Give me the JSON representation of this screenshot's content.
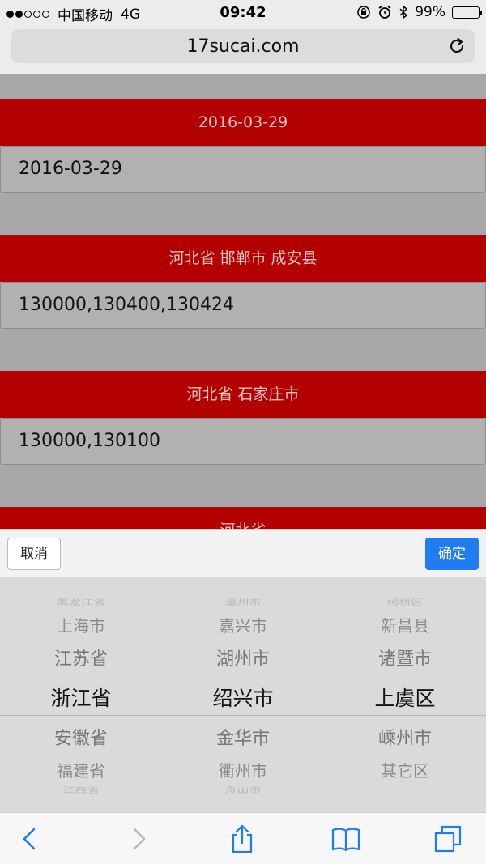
{
  "status": {
    "carrier": "中国移动",
    "network": "4G",
    "time": "09:42",
    "battery": "99%",
    "battery_level": 0.99
  },
  "browser": {
    "url": "17sucai.com"
  },
  "blocks": [
    {
      "title": "2016-03-29",
      "value": "2016-03-29"
    },
    {
      "title": "河北省 邯郸市 成安县",
      "value": "130000,130400,130424"
    },
    {
      "title": "河北省 石家庄市",
      "value": "130000,130100"
    },
    {
      "title": "河北省"
    }
  ],
  "picker": {
    "cancel_label": "取消",
    "confirm_label": "确定",
    "columns": [
      {
        "items": [
          "黑龙江省",
          "上海市",
          "江苏省",
          "浙江省",
          "安徽省",
          "福建省",
          "江西省"
        ],
        "selected": "浙江省"
      },
      {
        "items": [
          "温州市",
          "嘉兴市",
          "湖州市",
          "绍兴市",
          "金华市",
          "衢州市",
          "舟山市"
        ],
        "selected": "绍兴市"
      },
      {
        "items": [
          "柯桥区",
          "新昌县",
          "诸暨市",
          "上虞区",
          "嵊州市",
          "其它区",
          ""
        ],
        "selected": "上虞区"
      }
    ]
  },
  "colors": {
    "header_red": "#b30000",
    "confirm_blue": "#1f7cf3",
    "ios_blue": "#1f7cf3"
  },
  "icons": {
    "reload": "reload-icon",
    "back": "chevron-left-icon",
    "forward": "chevron-right-icon",
    "share": "share-icon",
    "bookmarks": "book-icon",
    "tabs": "tabs-icon"
  }
}
